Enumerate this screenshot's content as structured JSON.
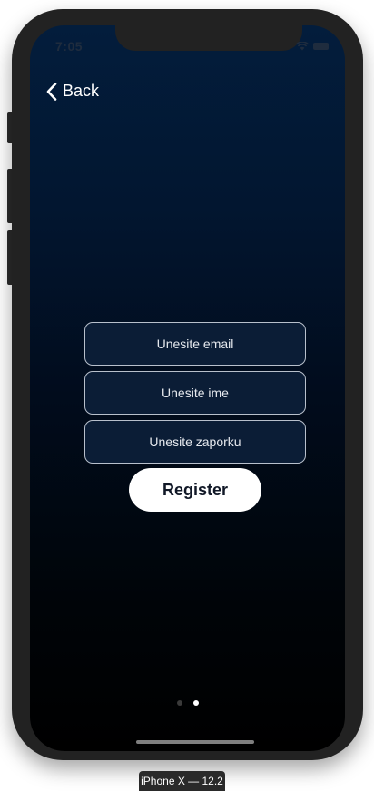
{
  "status_bar": {
    "time": "7:05",
    "icons": [
      "wifi-icon",
      "battery-icon"
    ]
  },
  "nav": {
    "back_label": "Back",
    "back_icon": "chevron-left-icon"
  },
  "form": {
    "email_placeholder": "Unesite email",
    "name_placeholder": "Unesite ime",
    "password_placeholder": "Unesite zaporku",
    "email_value": "",
    "name_value": "",
    "password_value": ""
  },
  "register_label": "Register",
  "pager": {
    "pages": 2,
    "active_index": 1
  },
  "device_caption": "iPhone X — 12.2",
  "colors": {
    "background_top": "#031d3c",
    "background_bottom": "#000000",
    "field_background": "#0b1d36",
    "field_border": "#b8c0cc",
    "button_background": "#ffffff",
    "button_text": "#111827",
    "device_frame": "#222222"
  }
}
